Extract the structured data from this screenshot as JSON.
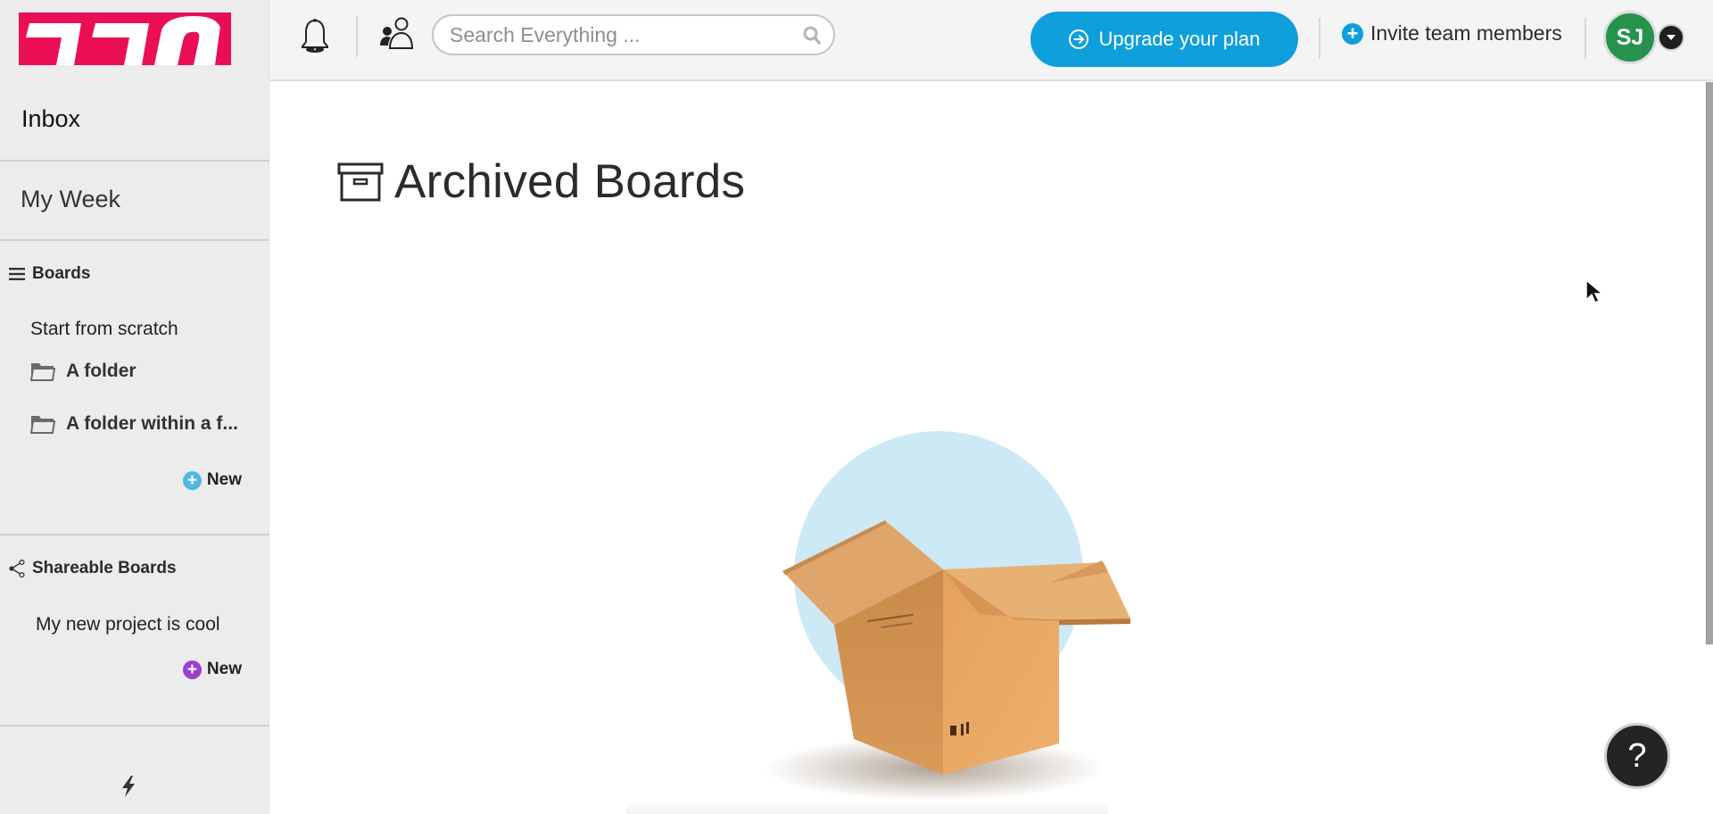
{
  "app": {
    "brand_color": "#ea0f55",
    "accent_color": "#0f9fdc"
  },
  "sidebar": {
    "logo": "monday-logo",
    "inbox_label": "Inbox",
    "my_week_label": "My Week",
    "boards": {
      "heading": "Boards",
      "icon": "hamburger-icon",
      "items": [
        {
          "label": "Start from scratch",
          "type": "board"
        },
        {
          "label": "A folder",
          "type": "folder",
          "icon": "folder-icon"
        },
        {
          "label": "A folder within a f...",
          "type": "folder",
          "icon": "folder-icon"
        }
      ],
      "new_label": "New",
      "new_icon_color": "#4fb8e6"
    },
    "shareable_boards": {
      "heading": "Shareable Boards",
      "icon": "share-icon",
      "items": [
        {
          "label": "My new project is cool"
        }
      ],
      "new_label": "New",
      "new_icon_color": "#9b3fd1"
    },
    "footer_icon": "bolt-icon"
  },
  "topbar": {
    "notifications_icon": "bell-icon",
    "people_icon": "people-icon",
    "search": {
      "placeholder": "Search Everything ...",
      "value": ""
    },
    "upgrade_label": "Upgrade your plan",
    "invite_label": "Invite team members",
    "avatar_initials": "SJ",
    "avatar_color": "#25934d"
  },
  "main": {
    "title": "Archived Boards",
    "title_icon": "archive-box-icon",
    "illustration": "open-cardboard-box",
    "help_label": "?"
  }
}
